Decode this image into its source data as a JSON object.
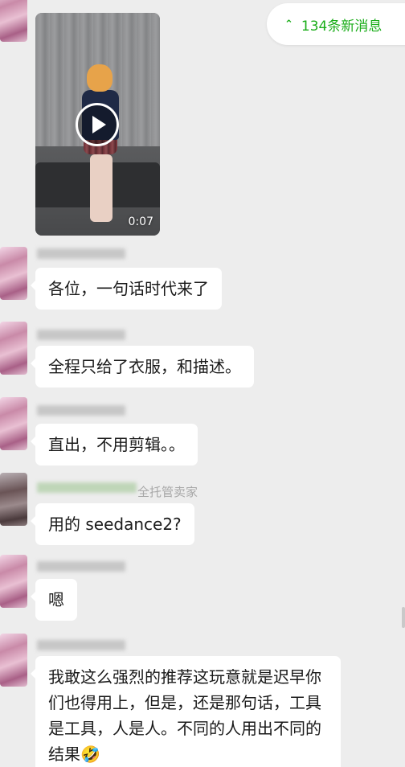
{
  "new_messages": {
    "label": "134条新消息",
    "icon": "double-chevron-up-icon"
  },
  "video": {
    "duration": "0:07",
    "icon": "play-icon"
  },
  "messages": [
    {
      "text": "各位，一句话时代来了"
    },
    {
      "text": "全程只给了衣服，和描述。"
    },
    {
      "text": "直出，不用剪辑。。"
    },
    {
      "sender_suffix": "全托管卖家",
      "text": "用的 seedance2?"
    },
    {
      "text": "嗯"
    },
    {
      "text": "我敢这么强烈的推荐这玩意就是迟早你们也得用上，但是，还是那句话，工具是工具，人是人。不同的人用出不同的结果🤣"
    }
  ]
}
